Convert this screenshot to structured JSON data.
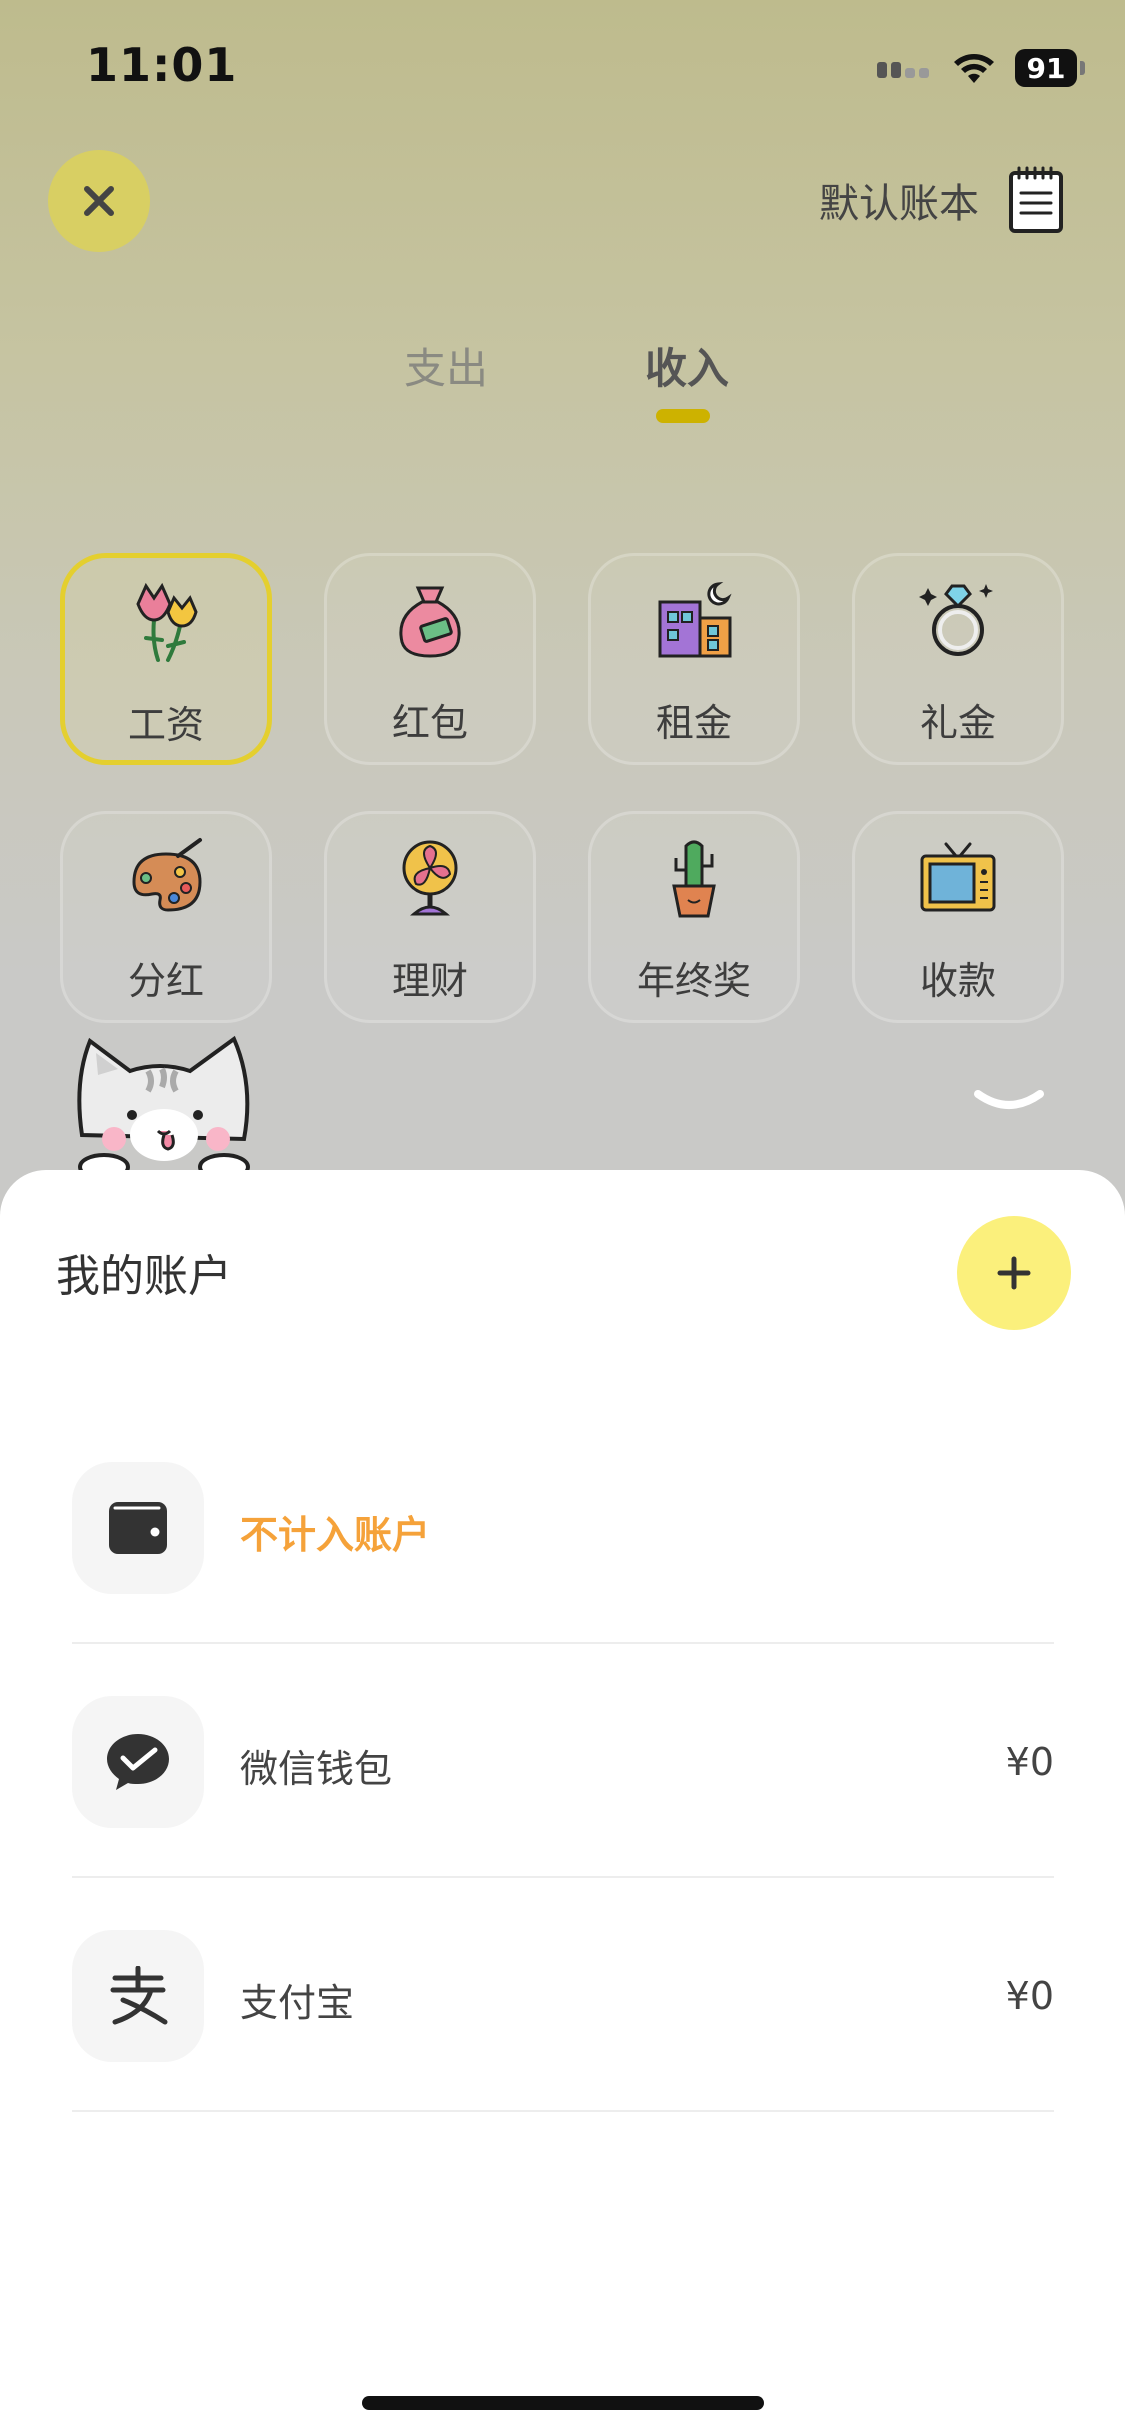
{
  "status_bar": {
    "time": "11:01",
    "battery": "91"
  },
  "header": {
    "ledger_label": "默认账本"
  },
  "tabs": [
    {
      "label": "支出",
      "active": false
    },
    {
      "label": "收入",
      "active": true
    }
  ],
  "categories": [
    {
      "label": "工资",
      "icon": "flowers-icon",
      "selected": true
    },
    {
      "label": "红包",
      "icon": "money-bag-icon",
      "selected": false
    },
    {
      "label": "租金",
      "icon": "buildings-icon",
      "selected": false
    },
    {
      "label": "礼金",
      "icon": "diamond-ring-icon",
      "selected": false
    },
    {
      "label": "分红",
      "icon": "palette-icon",
      "selected": false
    },
    {
      "label": "理财",
      "icon": "fan-icon",
      "selected": false
    },
    {
      "label": "年终奖",
      "icon": "cactus-icon",
      "selected": false
    },
    {
      "label": "收款",
      "icon": "tv-icon",
      "selected": false
    }
  ],
  "sheet": {
    "title": "我的账户",
    "accounts": [
      {
        "name": "不计入账户",
        "icon": "wallet-icon",
        "balance": "",
        "highlight": true
      },
      {
        "name": "微信钱包",
        "icon": "wechat-pay-icon",
        "balance": "¥0",
        "highlight": false
      },
      {
        "name": "支付宝",
        "icon": "alipay-icon",
        "balance": "¥0",
        "highlight": false
      }
    ]
  },
  "colors": {
    "accent_yellow": "#fbf07c",
    "selected_border": "#e4cf2f",
    "highlight_orange": "#f5a23a"
  }
}
